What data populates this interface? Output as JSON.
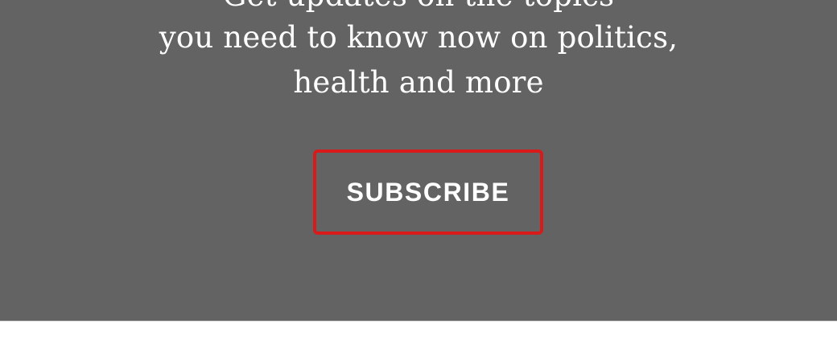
{
  "promo": {
    "line_partial": "Get updates on the topics",
    "line_1": "you need to know now on politics,",
    "line_2": "health and more",
    "subscribe_label": "SUBSCRIBE",
    "background_color": "#636363",
    "button_border_color": "#d91a1a"
  }
}
